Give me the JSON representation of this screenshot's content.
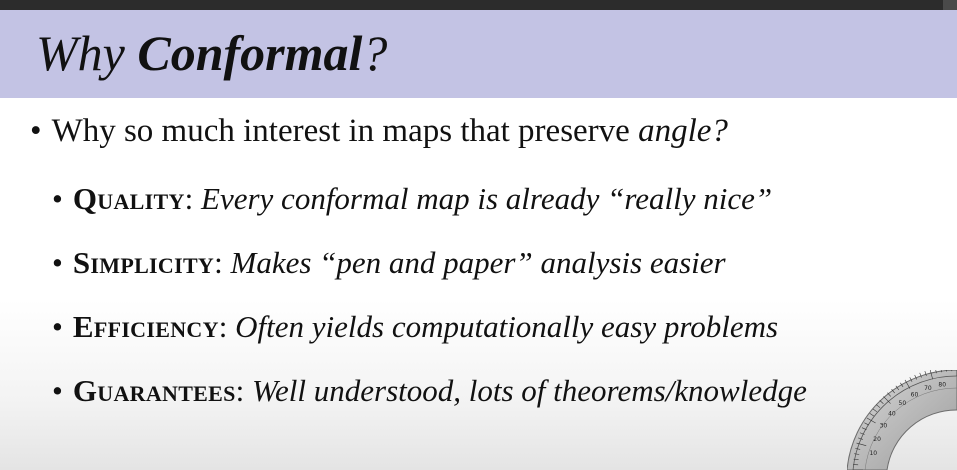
{
  "slide": {
    "title_plain": "Why ",
    "title_emph": "Conformal",
    "title_suffix": "?",
    "main_bullet": {
      "text": "Why so much interest in maps that preserve ",
      "emph": "angle?"
    },
    "sub_bullets": [
      {
        "term": "Quality",
        "sep": ": ",
        "desc": "Every conformal map is already “really nice”"
      },
      {
        "term": "Simplicity",
        "sep": ": ",
        "desc": "Makes “pen and paper” analysis easier"
      },
      {
        "term": "Efficiency",
        "sep": ": ",
        "desc": "Often yields computationally easy problems"
      },
      {
        "term": "Guarantees",
        "sep": ": ",
        "desc": "Well understood, lots of theorems/knowledge"
      }
    ]
  },
  "colors": {
    "title_band": "#c3c3e4",
    "text": "#111111"
  },
  "protractor_marks": [
    "10",
    "20",
    "30",
    "40",
    "50",
    "60",
    "70",
    "80"
  ]
}
